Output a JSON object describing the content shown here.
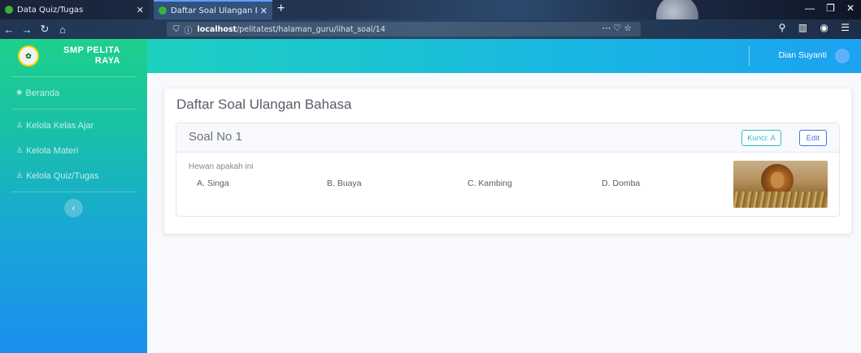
{
  "browser": {
    "tabs": [
      {
        "title": "Data Quiz/Tugas",
        "active": false
      },
      {
        "title": "Daftar Soal Ulangan Bahasa",
        "active": true
      }
    ],
    "url_host": "localhost",
    "url_path": "/pelitatest/halaman_guru/lihat_soal/14"
  },
  "sidebar": {
    "brand_line1": "SMP PELITA",
    "brand_line2": "RAYA",
    "items": [
      {
        "label": "Beranda",
        "icon": "dashboard-icon"
      },
      {
        "label": "Kelola Kelas Ajar",
        "icon": "user-icon"
      },
      {
        "label": "Kelola Materi",
        "icon": "user-icon"
      },
      {
        "label": "Kelola Quiz/Tugas",
        "icon": "user-icon"
      }
    ],
    "collapse_label": "‹"
  },
  "topbar": {
    "user_name": "Dian Suyanti"
  },
  "main": {
    "card_title": "Daftar Soal Ulangan Bahasa",
    "questions": [
      {
        "number_label": "Soal No 1",
        "key_label": "Kunci: A",
        "edit_label": "Edit",
        "text": "Hewan apakah ini",
        "options": [
          "A. Singa",
          "B. Buaya",
          "C. Kambing",
          "D. Domba"
        ],
        "image": "lion-image"
      }
    ]
  },
  "colors": {
    "accent": "#4e73df",
    "info": "#36b9cc",
    "sidebar_top": "#1ed08a",
    "sidebar_bottom": "#1b8ff0"
  }
}
